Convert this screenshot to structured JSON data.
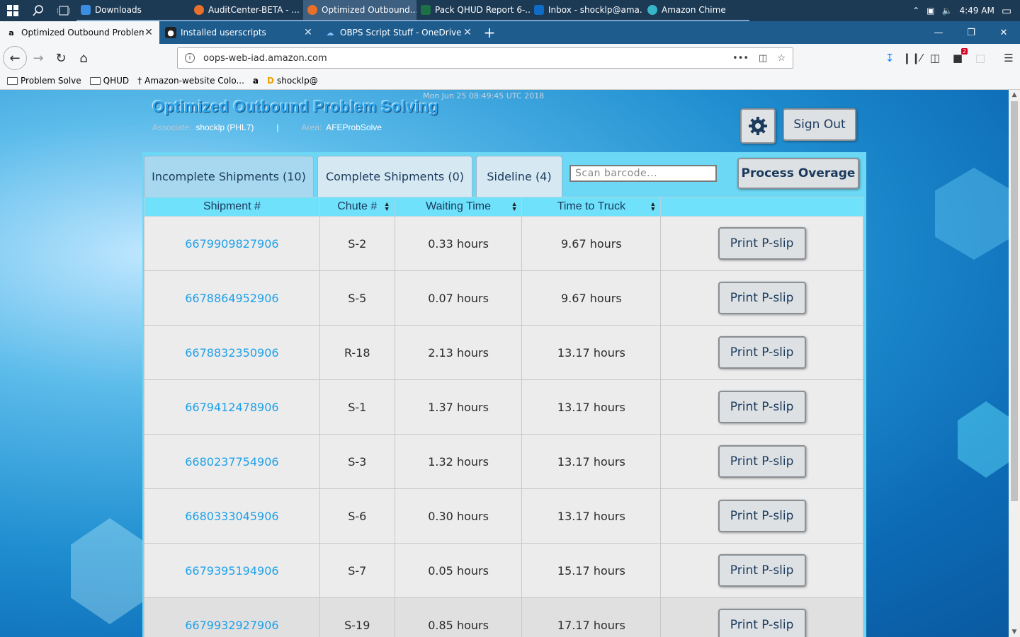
{
  "taskbar": {
    "apps": [
      {
        "label": "Downloads",
        "active": false
      },
      {
        "label": "AuditCenter-BETA - ...",
        "active": false
      },
      {
        "label": "Optimized Outbound...",
        "active": true
      },
      {
        "label": "Pack QHUD Report 6-...",
        "active": false
      },
      {
        "label": "Inbox - shocklp@ama...",
        "active": false
      },
      {
        "label": "Amazon Chime",
        "active": false
      }
    ],
    "clock": "4:49 AM"
  },
  "browser": {
    "tabs": [
      {
        "label": "Optimized Outbound Problem",
        "active": true
      },
      {
        "label": "Installed userscripts",
        "active": false
      },
      {
        "label": "OBPS Script Stuff - OneDrive",
        "active": false
      }
    ],
    "url": "oops-web-iad.amazon.com",
    "badge_count": "2",
    "bookmarks": [
      "Problem Solve",
      "QHUD",
      "Amazon-website Colo...",
      "shocklp@"
    ]
  },
  "app": {
    "title": "Optimized Outbound Problem Solving",
    "timestamp": "Mon Jun 25 08:49:45 UTC 2018",
    "associate_label": "Associate:",
    "associate_value": "shocklp (PHL7)",
    "separator": "|",
    "area_label": "Area:",
    "area_value": "AFEProbSolve",
    "sign_out": "Sign Out",
    "settings_icon": "gear-icon",
    "tabs": {
      "incomplete": "Incomplete Shipments (10)",
      "complete": "Complete Shipments (0)",
      "sideline": "Sideline (4)"
    },
    "scan_placeholder": "Scan barcode...",
    "process_overage": "Process Overage",
    "columns": {
      "shipment": "Shipment #",
      "chute": "Chute #",
      "waiting": "Waiting Time",
      "truck": "Time to Truck"
    },
    "print_label": "Print P-slip",
    "rows": [
      {
        "shipment": "6679909827906",
        "chute": "S-2",
        "waiting": "0.33 hours",
        "truck": "9.67 hours"
      },
      {
        "shipment": "6678864952906",
        "chute": "S-5",
        "waiting": "0.07 hours",
        "truck": "9.67 hours"
      },
      {
        "shipment": "6678832350906",
        "chute": "R-18",
        "waiting": "2.13 hours",
        "truck": "13.17 hours"
      },
      {
        "shipment": "6679412478906",
        "chute": "S-1",
        "waiting": "1.37 hours",
        "truck": "13.17 hours"
      },
      {
        "shipment": "6680237754906",
        "chute": "S-3",
        "waiting": "1.32 hours",
        "truck": "13.17 hours"
      },
      {
        "shipment": "6680333045906",
        "chute": "S-6",
        "waiting": "0.30 hours",
        "truck": "13.17 hours"
      },
      {
        "shipment": "6679395194906",
        "chute": "S-7",
        "waiting": "0.05 hours",
        "truck": "15.17 hours"
      },
      {
        "shipment": "6679932927906",
        "chute": "S-19",
        "waiting": "0.85 hours",
        "truck": "17.17 hours"
      }
    ]
  }
}
